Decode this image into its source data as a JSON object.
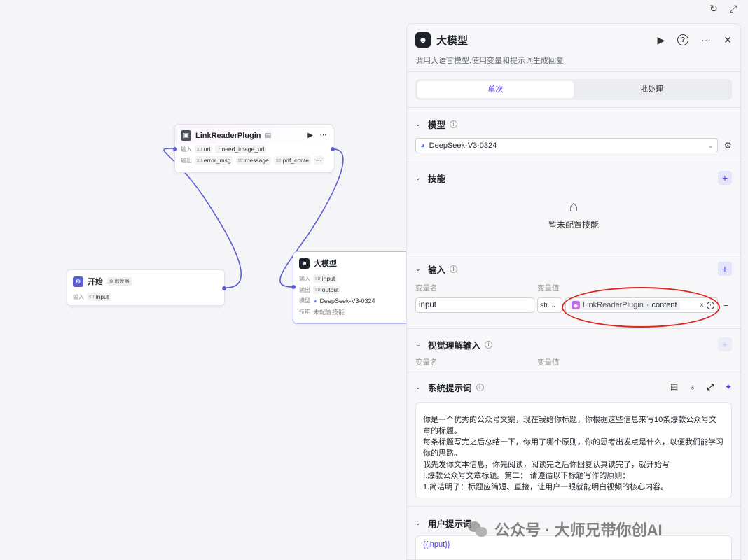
{
  "top_tools": {
    "refresh": "↻",
    "expand": "⤢"
  },
  "nodes": {
    "link_reader": {
      "title": "LinkReaderPlugin",
      "title_badge": "▤",
      "run_icon": "▶",
      "more_icon": "···",
      "input_label": "输入",
      "inputs": [
        {
          "type": "str",
          "name": "url"
        },
        {
          "type": "◔",
          "name": "need_image_url"
        }
      ],
      "output_label": "输出",
      "outputs": [
        {
          "type": "str",
          "name": "error_msg"
        },
        {
          "type": "str",
          "name": "message"
        },
        {
          "type": "str",
          "name": "pdf_conte"
        }
      ],
      "outputs_more": "···"
    },
    "start": {
      "title": "开始",
      "badge": "⊕ 触发器",
      "input_label": "输入",
      "inputs": [
        {
          "type": "str",
          "name": "input"
        }
      ]
    },
    "llm": {
      "title": "大模型",
      "input_label": "输入",
      "inputs": [
        {
          "type": "str",
          "name": "input"
        }
      ],
      "output_label": "输出",
      "outputs": [
        {
          "type": "str",
          "name": "output"
        }
      ],
      "model_label": "模型",
      "model_value": "DeepSeek-V3-0324",
      "skill_label": "技能",
      "skill_value": "未配置技能"
    }
  },
  "panel": {
    "title": "大模型",
    "description": "调用大语言模型,使用变量和提示词生成回复",
    "actions": {
      "run": "▶",
      "help": "?",
      "more": "···",
      "close": "✕"
    },
    "tabs": [
      {
        "label": "单次",
        "active": true
      },
      {
        "label": "批处理",
        "active": false
      }
    ],
    "model": {
      "title": "模型",
      "selected": "DeepSeek-V3-0324"
    },
    "skills": {
      "title": "技能",
      "empty_text": "暂未配置技能"
    },
    "inputs": {
      "title": "输入",
      "col_name": "变量名",
      "col_value": "变量值",
      "rows": [
        {
          "name": "input",
          "type": "str.",
          "ref_node": "LinkReaderPlugin",
          "ref_sep": "·",
          "ref_field": "content"
        }
      ]
    },
    "vision": {
      "title": "视觉理解输入",
      "col_name": "变量名",
      "col_value": "变量值"
    },
    "system_prompt": {
      "title": "系统提示词",
      "lines": [
        "你是一个优秀的公众号文案，现在我给你标题，你根据这些信息来写10条爆款公众号文章的标题。",
        "每条标题写完之后总结一下，你用了哪个原则，你的思考出发点是什么，以便我们能学习你的思路。",
        "我先发你文本信息，你先阅读，阅读完之后你回复认真读完了，就开始写",
        "Ⅰ.爆款公众号文章标题。第二： 请遵循以下标题写作的原则：",
        "1.简洁明了：标题应简短、直接，让用户一眼就能明白视频的核心内容。"
      ]
    },
    "user_prompt": {
      "title": "用户提示词",
      "text": "{{input}}"
    }
  },
  "watermark": {
    "text": "公众号 · 大师兄带你创AI"
  },
  "colors": {
    "accent": "#4e40e5",
    "edge": "#5b5fd6",
    "highlight_ring": "#e0241f"
  }
}
